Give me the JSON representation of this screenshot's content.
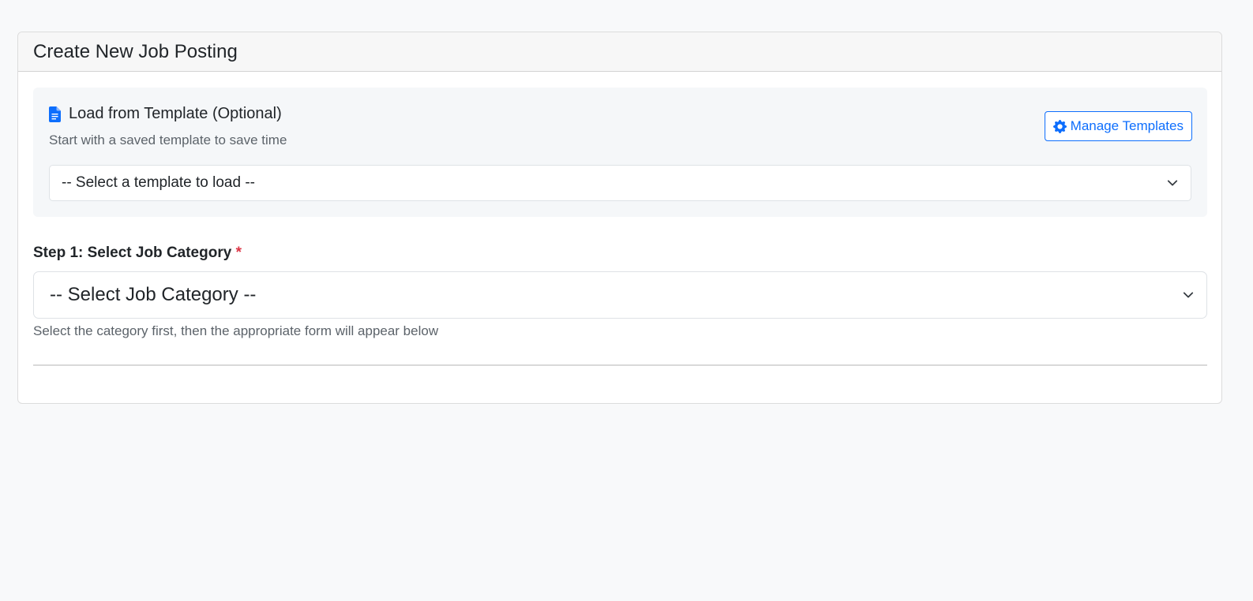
{
  "card": {
    "title": "Create New Job Posting"
  },
  "template_panel": {
    "heading": "Load from Template (Optional)",
    "subtitle": "Start with a saved template to save time",
    "manage_button_label": "Manage Templates",
    "select_value": "-- Select a template to load --",
    "heading_icon": "file-text-icon",
    "manage_icon": "gear-icon"
  },
  "step1": {
    "label": "Step 1: Select Job Category",
    "required_marker": "*",
    "select_value": "-- Select Job Category --",
    "help_text": "Select the category first, then the appropriate form will appear below"
  },
  "colors": {
    "primary": "#0d6efd",
    "required": "#dc3545",
    "background": "#f8f9fa",
    "panel": "#f5f7f9"
  }
}
